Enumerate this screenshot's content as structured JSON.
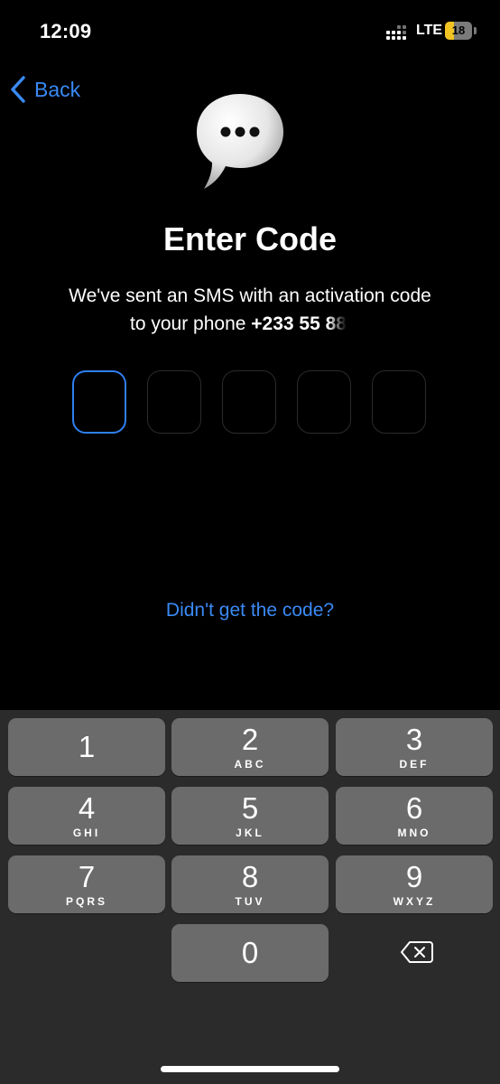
{
  "status_bar": {
    "time": "12:09",
    "carrier": "LTE",
    "battery": "18",
    "battery_level": 0.18
  },
  "nav": {
    "back_label": "Back"
  },
  "header": {
    "icon": "speech-bubble-icon",
    "title": "Enter Code",
    "subtitle_line1": "We've sent an SMS with an activation code",
    "subtitle_line2_prefix": "to your phone ",
    "phone": "+233 55 88"
  },
  "code_input": {
    "length": 5,
    "active_index": 0,
    "values": [
      "",
      "",
      "",
      "",
      ""
    ]
  },
  "resend_link": "Didn't get the code?",
  "keypad": {
    "keys": [
      {
        "digit": "1",
        "letters": ""
      },
      {
        "digit": "2",
        "letters": "ABC"
      },
      {
        "digit": "3",
        "letters": "DEF"
      },
      {
        "digit": "4",
        "letters": "GHI"
      },
      {
        "digit": "5",
        "letters": "JKL"
      },
      {
        "digit": "6",
        "letters": "MNO"
      },
      {
        "digit": "7",
        "letters": "PQRS"
      },
      {
        "digit": "8",
        "letters": "TUV"
      },
      {
        "digit": "9",
        "letters": "WXYZ"
      },
      {
        "digit": "0",
        "letters": ""
      }
    ],
    "delete_icon": "backspace-icon"
  },
  "colors": {
    "accent": "#3a8af5",
    "active_border": "#2f7ff0",
    "background": "#000000",
    "keypad_bg": "#2b2b2b",
    "key_bg": "#6b6b6b"
  }
}
